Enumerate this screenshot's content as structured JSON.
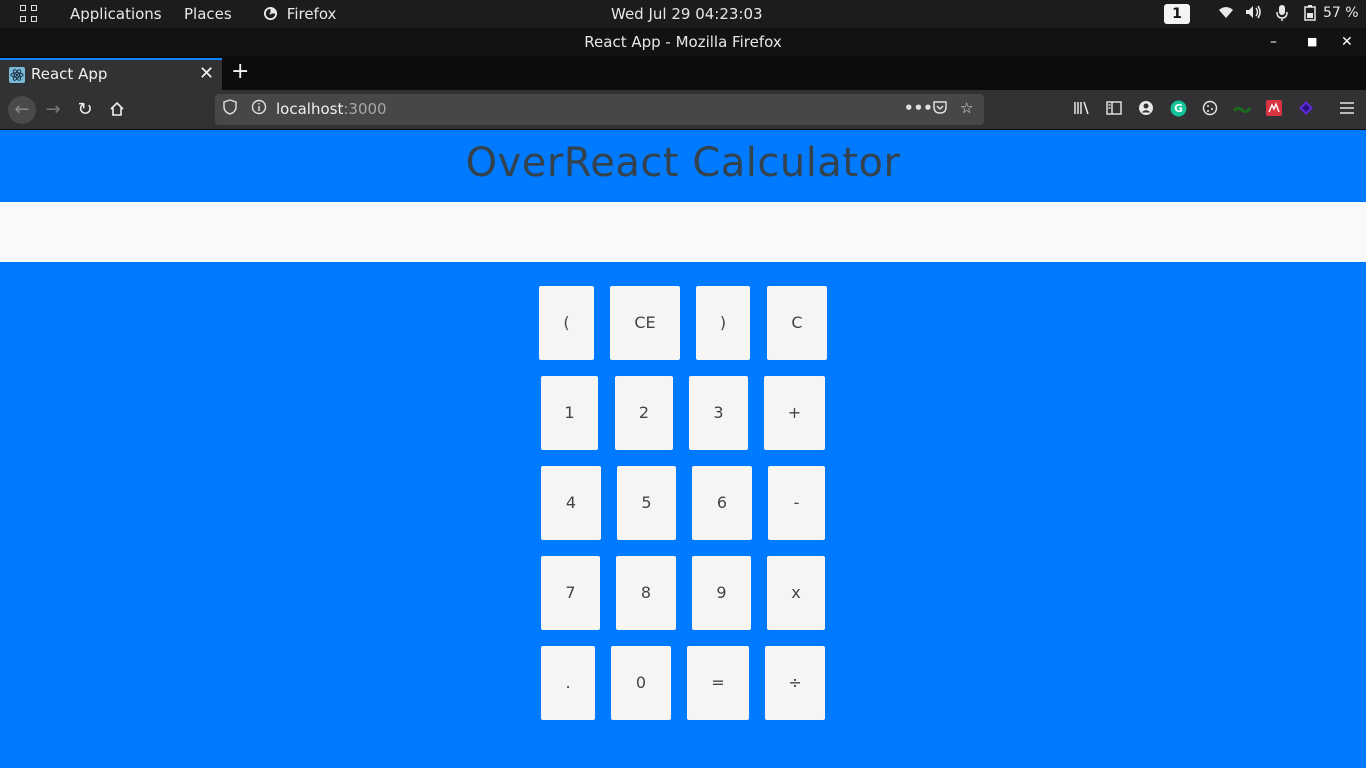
{
  "topbar": {
    "menus": [
      "Applications",
      "Places",
      "Firefox"
    ],
    "clock": "Wed Jul 29  04:23:03",
    "workspace": "1",
    "battery": "57 %"
  },
  "window": {
    "title": "React App - Mozilla Firefox"
  },
  "tabs": [
    {
      "label": "React App",
      "active": true
    }
  ],
  "urlbar": {
    "host": "localhost",
    "port": ":3000"
  },
  "app": {
    "title": "OverReact Calculator",
    "display_value": "",
    "keys": [
      [
        "(",
        "CE",
        ")",
        "C"
      ],
      [
        "1",
        "2",
        "3",
        "+"
      ],
      [
        "4",
        "5",
        "6",
        "-"
      ],
      [
        "7",
        "8",
        "9",
        "x"
      ],
      [
        ".",
        "0",
        "=",
        "÷"
      ]
    ]
  },
  "colors": {
    "page_bg": "#007bff",
    "display_bg": "#f8f9fa",
    "key_bg": "#f6f5f3",
    "title_color": "#34424d",
    "firefox_accent": "#0a84ff"
  },
  "icons": [
    "activities-grid-icon",
    "firefox-icon",
    "wifi-icon",
    "volume-icon",
    "microphone-icon",
    "battery-icon",
    "react-favicon-icon",
    "back-icon",
    "forward-icon",
    "reload-icon",
    "home-icon",
    "shield-icon",
    "info-icon",
    "page-actions-icon",
    "pocket-icon",
    "bookmark-star-icon",
    "library-icon",
    "sidebar-icon",
    "account-icon",
    "grammarly-icon",
    "cookie-icon",
    "extension-icon",
    "extension-red-icon",
    "extension-purple-icon",
    "hamburger-menu-icon"
  ]
}
